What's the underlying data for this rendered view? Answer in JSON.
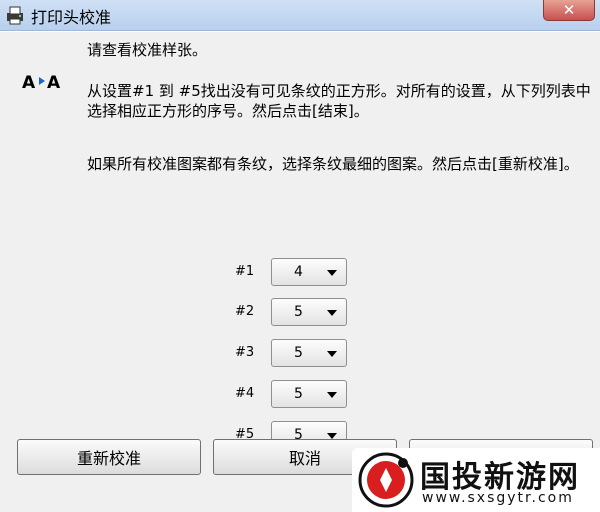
{
  "window": {
    "title": "打印头校准",
    "close_label": "✕"
  },
  "dialog": {
    "intro": "请查看校准样张。",
    "aa_label": "A▸A",
    "paragraph1": "从设置#1 到 #5找出没有可见条纹的正方形。对所有的设置，从下列列表中选择相应正方形的序号。然后点击[结束]。",
    "paragraph2": "如果所有校准图案都有条纹，选择条纹最细的图案。然后点击[重新校准]。",
    "patterns": [
      {
        "label": "#1",
        "value": "4"
      },
      {
        "label": "#2",
        "value": "5"
      },
      {
        "label": "#3",
        "value": "5"
      },
      {
        "label": "#4",
        "value": "5"
      },
      {
        "label": "#5",
        "value": "5"
      }
    ],
    "buttons": {
      "recalibrate": "重新校准",
      "cancel": "取消"
    }
  },
  "overlay": {
    "logo_text": "国投新游网",
    "logo_url": "www.sxsgytr.com",
    "logo_color": "#d81e1e"
  },
  "colors": {
    "titlebar": "#c5daf2",
    "background": "#f0f0f0",
    "close": "#c75050"
  }
}
